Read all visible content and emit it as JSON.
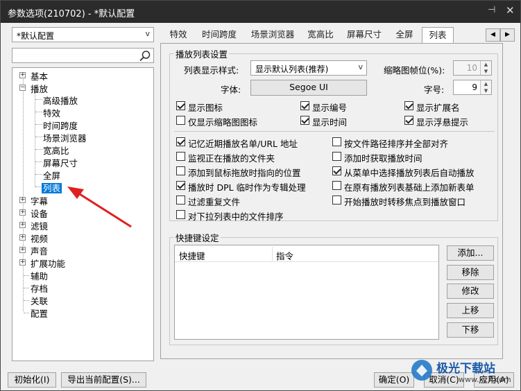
{
  "window": {
    "title": "参数选项(210702) - *默认配置",
    "pin_icon": "pin-icon",
    "close_icon": "close-icon"
  },
  "profile": {
    "selected": "*默认配置"
  },
  "search": {
    "placeholder": ""
  },
  "tree": {
    "basic": "基本",
    "playback": "播放",
    "playback_children": [
      "高级播放",
      "特效",
      "时间跨度",
      "场景浏览器",
      "宽高比",
      "屏幕尺寸",
      "全屏",
      "列表"
    ],
    "subtitles": "字幕",
    "devices": "设备",
    "filters": "滤镜",
    "video": "视频",
    "sound": "声音",
    "extensions": "扩展功能",
    "assist": "辅助",
    "archive": "存档",
    "association": "关联",
    "config": "配置"
  },
  "tabs": [
    "特效",
    "时间跨度",
    "场景浏览器",
    "宽高比",
    "屏幕尺寸",
    "全屏",
    "列表"
  ],
  "playlist_settings": {
    "group_label": "播放列表设置",
    "display_style_label": "列表显示样式:",
    "display_style_value": "显示默认列表(推荐)",
    "thumb_frame_label": "缩略图帧位(%):",
    "thumb_frame_value": "10",
    "font_label": "字体:",
    "font_value": "Segoe UI",
    "font_size_label": "字号:",
    "font_size_value": "9"
  },
  "checkboxes_top": [
    {
      "label": "显示图标",
      "checked": true
    },
    {
      "label": "显示编号",
      "checked": true
    },
    {
      "label": "显示扩展名",
      "checked": true
    },
    {
      "label": "仅显示缩略图图标",
      "checked": false
    },
    {
      "label": "显示时间",
      "checked": true
    },
    {
      "label": "显示浮悬提示",
      "checked": true
    }
  ],
  "checkboxes_left": [
    {
      "label": "记忆近期播放名单/URL 地址",
      "checked": true
    },
    {
      "label": "监视正在播放的文件夹",
      "checked": false
    },
    {
      "label": "添加到鼠标拖放时指向的位置",
      "checked": false
    },
    {
      "label": "播放时 DPL 临时作为专辑处理",
      "checked": true
    },
    {
      "label": "过滤重复文件",
      "checked": false
    },
    {
      "label": "对下拉列表中的文件排序",
      "checked": false
    }
  ],
  "checkboxes_right": [
    {
      "label": "按文件路径排序并全部对齐",
      "checked": false
    },
    {
      "label": "添加时获取播放时间",
      "checked": false
    },
    {
      "label": "从菜单中选择播放列表后自动播放",
      "checked": true
    },
    {
      "label": "在原有播放列表基础上添加新表单",
      "checked": false
    },
    {
      "label": "开始播放时转移焦点到播放窗口",
      "checked": false
    }
  ],
  "shortcuts": {
    "group_label": "快捷键设定",
    "col_key": "快捷键",
    "col_cmd": "指令",
    "buttons": [
      "添加...",
      "移除",
      "修改",
      "上移",
      "下移"
    ]
  },
  "footer": {
    "init": "初始化(I)",
    "export": "导出当前配置(S)...",
    "ok": "确定(O)",
    "cancel": "取消(C)",
    "apply": "应用(A)"
  },
  "watermark": {
    "text": "极光下载站",
    "url": "www.xz7.com"
  },
  "colors": {
    "titlebar": "#2b2b2b",
    "selection": "#0078d7",
    "arrow": "#e02020"
  }
}
